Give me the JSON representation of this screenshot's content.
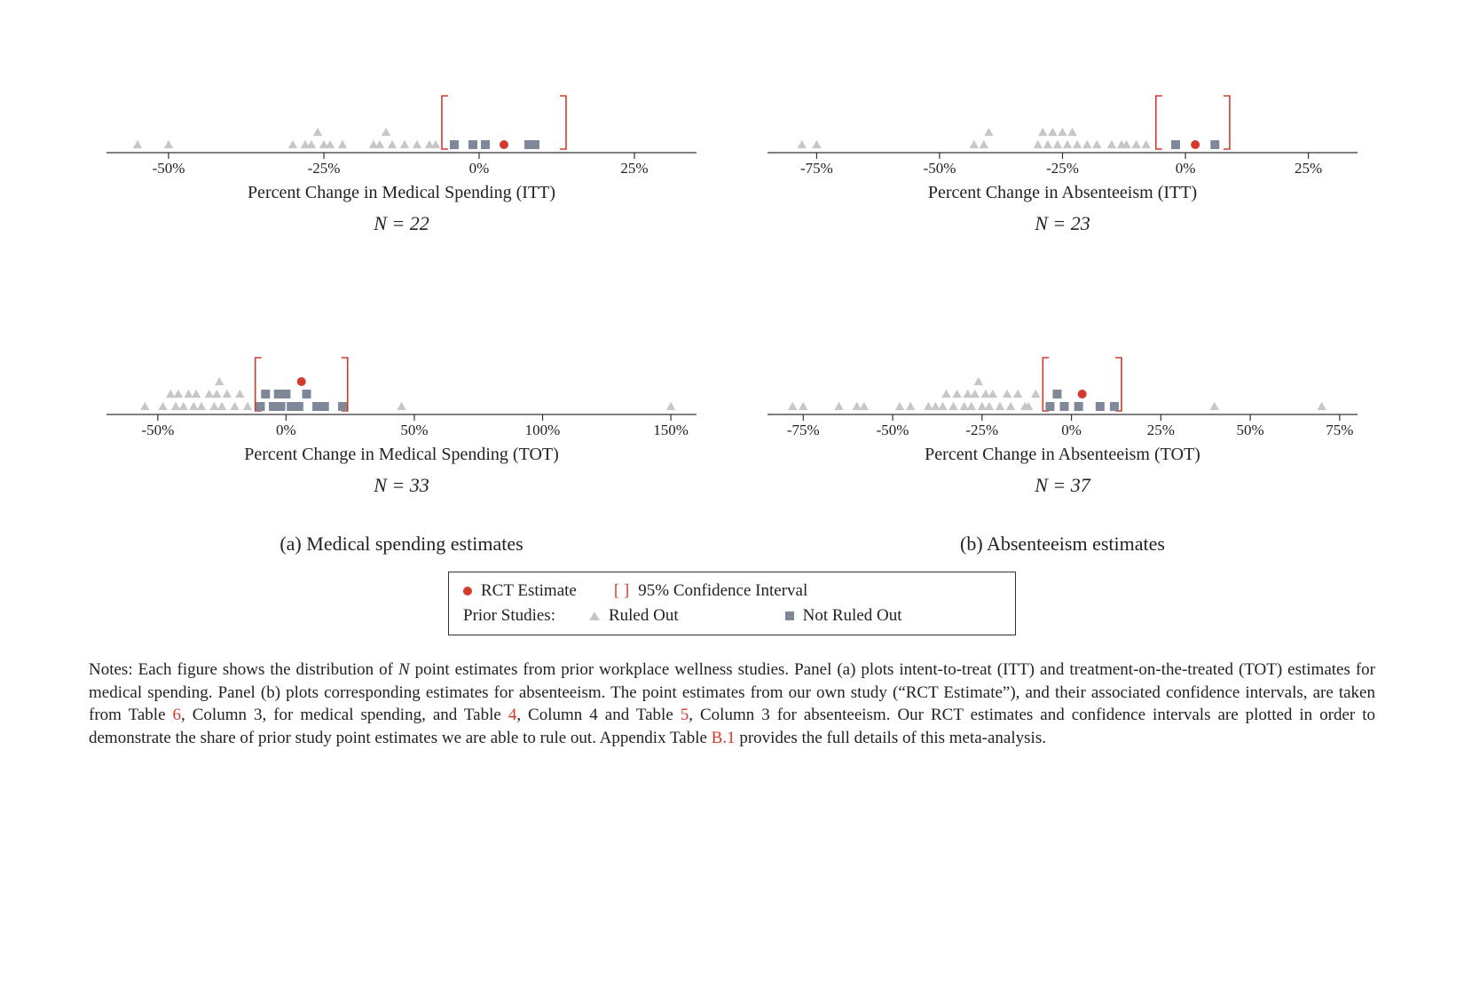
{
  "chart_data": [
    {
      "id": "med_itt",
      "type": "dotstrip",
      "xlabel": "Percent Change in Medical Spending (ITT)",
      "n_label": "N = 22",
      "xlim": [
        -60,
        35
      ],
      "ticks": [
        -50,
        -25,
        0,
        25
      ],
      "rct_estimate": 4,
      "ci": [
        -6,
        14
      ],
      "ruled_out_points": [
        -55,
        -50,
        -30,
        -28,
        -27,
        -26,
        -25,
        -24,
        -22,
        -17,
        -16,
        -15,
        -14,
        -12,
        -10,
        -8,
        -7
      ],
      "not_ruled_out_points": [
        -4,
        -1,
        1,
        8,
        9
      ]
    },
    {
      "id": "abs_itt",
      "type": "dotstrip",
      "xlabel": "Percent Change in Absenteeism (ITT)",
      "n_label": "N = 23",
      "xlim": [
        -85,
        35
      ],
      "ticks": [
        -75,
        -50,
        -25,
        0,
        25
      ],
      "rct_estimate": 2,
      "ci": [
        -6,
        9
      ],
      "ruled_out_points": [
        -78,
        -75,
        -43,
        -41,
        -40,
        -30,
        -29,
        -28,
        -27,
        -26,
        -25,
        -24,
        -23,
        -22,
        -20,
        -18,
        -15,
        -13,
        -12,
        -10,
        -8
      ],
      "not_ruled_out_points": [
        -2,
        6
      ]
    },
    {
      "id": "med_tot",
      "type": "dotstrip",
      "xlabel": "Percent Change in Medical Spending (TOT)",
      "n_label": "N = 33",
      "xlim": [
        -70,
        160
      ],
      "ticks": [
        -50,
        0,
        50,
        100,
        150
      ],
      "rct_estimate": 6,
      "ci": [
        -12,
        24
      ],
      "ruled_out_points": [
        -55,
        -48,
        -45,
        -43,
        -42,
        -40,
        -38,
        -36,
        -35,
        -33,
        -30,
        -28,
        -27,
        -26,
        -25,
        -23,
        -20,
        -18,
        -15,
        45,
        150
      ],
      "not_ruled_out_points": [
        -10,
        -8,
        -5,
        -3,
        -2,
        0,
        2,
        5,
        8,
        12,
        15,
        22
      ]
    },
    {
      "id": "abs_tot",
      "type": "dotstrip",
      "xlabel": "Percent Change in Absenteeism (TOT)",
      "n_label": "N = 37",
      "xlim": [
        -85,
        80
      ],
      "ticks": [
        -75,
        -50,
        -25,
        0,
        25,
        50,
        75
      ],
      "rct_estimate": 3,
      "ci": [
        -8,
        14
      ],
      "ruled_out_points": [
        -78,
        -75,
        -65,
        -60,
        -58,
        -48,
        -45,
        -40,
        -38,
        -36,
        -35,
        -33,
        -32,
        -30,
        -29,
        -28,
        -27,
        -26,
        -25,
        -24,
        -23,
        -22,
        -20,
        -18,
        -17,
        -15,
        -13,
        -12,
        -10,
        40,
        70
      ],
      "not_ruled_out_points": [
        -6,
        -4,
        -2,
        2,
        8,
        12
      ]
    }
  ],
  "captions": {
    "a": "(a) Medical spending estimates",
    "b": "(b) Absenteeism estimates"
  },
  "legend": {
    "rct": "RCT Estimate",
    "ci": "95% Confidence Interval",
    "prior": "Prior Studies:",
    "ruled": "Ruled Out",
    "notruled": "Not Ruled Out"
  },
  "notes": {
    "pre": "Notes: Each figure shows the distribution of ",
    "n_it": "N",
    "t1": " point estimates from prior workplace wellness studies. Panel (a) plots intent-to-treat (ITT) and treatment-on-the-treated (TOT) estimates for medical spending. Panel (b) plots corresponding estimates for absenteeism. The point estimates from our own study (“RCT Estimate”), and their associated confidence intervals, are taken from Table ",
    "link1": "6",
    "t2": ", Column 3, for medical spending, and Table ",
    "link2": "4",
    "t3": ", Column 4 and Table ",
    "link3": "5",
    "t4": ", Column 3 for absenteeism. Our RCT estimates and confidence intervals are plotted in order to demonstrate the share of prior study point estimates we are able to rule out. Appendix Table ",
    "link4": "B.1",
    "t5": " provides the full details of this meta-analysis."
  }
}
